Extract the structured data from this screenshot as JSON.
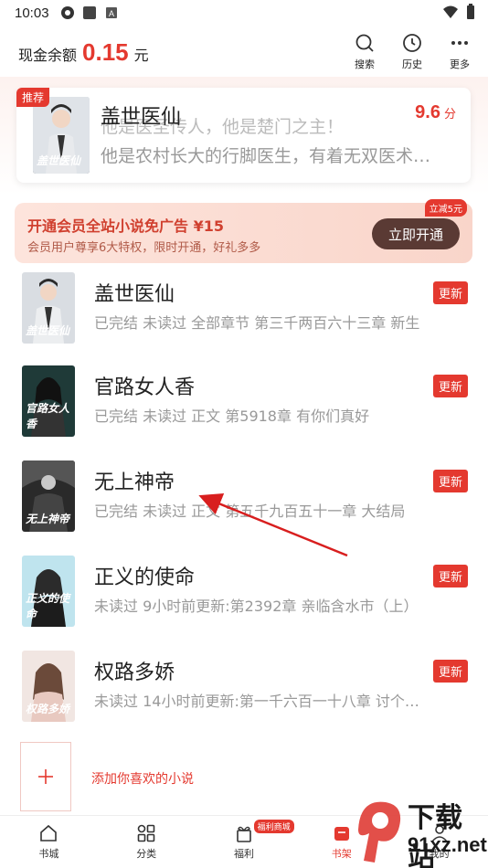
{
  "status_bar": {
    "time": "10:03"
  },
  "header": {
    "balance_label": "现金余额",
    "balance_value": "0.15",
    "balance_unit": "元",
    "actions": [
      {
        "label": "搜索",
        "icon": "search-icon"
      },
      {
        "label": "历史",
        "icon": "clock-icon"
      },
      {
        "label": "更多",
        "icon": "more-icon"
      }
    ]
  },
  "recommend": {
    "tag": "推荐",
    "title": "盖世医仙",
    "score": "9.6",
    "score_unit": "分",
    "line1": "他是医圣传人，他是楚门之主！",
    "line2": "他是农村长大的行脚医生，有着无双医术…",
    "cover_text": "盖世医仙"
  },
  "vip": {
    "title": "开通会员全站小说免广告 ¥15",
    "subtitle": "会员用户尊享6大特权，限时开通，好礼多多",
    "button": "立即开通",
    "badge": "立减5元"
  },
  "shelf": [
    {
      "title": "盖世医仙",
      "meta": "已完结 未读过 全部章节 第三千两百六十三章  新生",
      "badge": "更新",
      "cover_text": "盖世医仙"
    },
    {
      "title": "官路女人香",
      "meta": "已完结 未读过 正文 第5918章 有你们真好",
      "badge": "更新",
      "cover_text": "官路女人香"
    },
    {
      "title": "无上神帝",
      "meta": "已完结 未读过 正文 第五千九百五十一章  大结局",
      "badge": "更新",
      "cover_text": "无上神帝"
    },
    {
      "title": "正义的使命",
      "meta": "未读过 9小时前更新:第2392章 亲临含水市（上）",
      "badge": "更新",
      "cover_text": "正义的使命"
    },
    {
      "title": "权路多娇",
      "meta": "未读过 14小时前更新:第一千六百一十八章  讨个…",
      "badge": "更新",
      "cover_text": "权路多娇"
    }
  ],
  "add_label": "添加你喜欢的小说",
  "bottom_nav": [
    {
      "label": "书城",
      "icon": "home-icon"
    },
    {
      "label": "分类",
      "icon": "grid-icon"
    },
    {
      "label": "福利",
      "icon": "gift-icon",
      "badge": "福利商城"
    },
    {
      "label": "书架",
      "icon": "bookshelf-icon"
    },
    {
      "label": "我的",
      "icon": "user-icon"
    }
  ],
  "watermark": {
    "text1": "下载站",
    "text2": "91xz.net"
  },
  "colors": {
    "accent": "#e4392f",
    "vip_button": "#5a3a34"
  }
}
